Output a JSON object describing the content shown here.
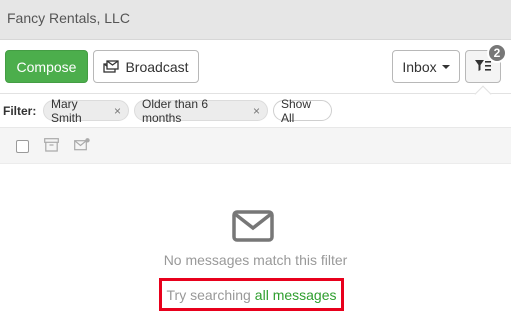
{
  "header": {
    "title": "Fancy Rentals, LLC"
  },
  "toolbar": {
    "compose_label": "Compose",
    "broadcast_label": "Broadcast",
    "inbox_label": "Inbox",
    "filter_badge_count": "2"
  },
  "filters": {
    "label": "Filter:",
    "chips": [
      {
        "label": "Mary Smith",
        "remove": "×"
      },
      {
        "label": "Older than 6 months",
        "remove": "×"
      }
    ],
    "show_all_label": "Show All"
  },
  "empty_state": {
    "message": "No messages match this filter",
    "try_prefix": "Try searching",
    "try_link": "all messages"
  },
  "icons": {
    "broadcast": "broadcast-icon",
    "filter": "filter-icon",
    "archive": "archive-icon",
    "mark_unread": "mark-unread-icon",
    "envelope": "envelope-icon"
  },
  "colors": {
    "compose": "#4cae4c",
    "link": "#2e9e2e",
    "highlight_border": "#e8001c",
    "badge": "#777777"
  }
}
